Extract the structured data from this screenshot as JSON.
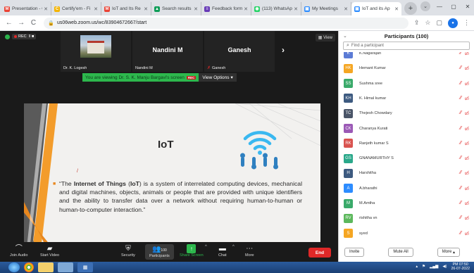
{
  "browser": {
    "tabs": [
      {
        "label": "Presentation - G",
        "fav_color": "#ea4335",
        "fav_glyph": "M"
      },
      {
        "label": "Certify'em - Fi",
        "fav_color": "#f4b400",
        "fav_glyph": "C"
      },
      {
        "label": "IoT and Its Re",
        "fav_color": "#ea4335",
        "fav_glyph": "M"
      },
      {
        "label": "Search results",
        "fav_color": "#0f9d58",
        "fav_glyph": "▲"
      },
      {
        "label": "Feedback form",
        "fav_color": "#673ab7",
        "fav_glyph": "≡"
      },
      {
        "label": "(113) WhatsApp",
        "fav_color": "#25d366",
        "fav_glyph": "◉"
      },
      {
        "label": "My Meetings",
        "fav_color": "#2d8cff",
        "fav_glyph": "▣"
      },
      {
        "label": "IoT and its Ap",
        "fav_color": "#2d8cff",
        "fav_glyph": "▣"
      }
    ],
    "url": "us06web.zoom.us/wc/83904672667/start"
  },
  "zoom": {
    "view_label": "View",
    "thumbnails": [
      {
        "name": "Dr. K. Logesh",
        "big": ""
      },
      {
        "name": "Nandini M",
        "big": "Nandini M"
      },
      {
        "name": "Ganesh",
        "big": "Ganesh"
      }
    ],
    "banner_text": "You are viewing Dr. S. K. Manju Bargavi's screen",
    "rec_badge": "REC",
    "view_options": "View Options",
    "slide": {
      "title": "IoT",
      "body_pre": "“The ",
      "body_bold1": "Internet of Things",
      "body_mid": " (",
      "body_bold2": "IoT",
      "body_post": ") is a system of interrelated computing devices, mechanical and digital machines, objects, animals or people that are provided with unique identifiers and the ability to transfer data over a network without requiring human-to-human or human-to-computer interaction.”"
    },
    "toolbar": {
      "join_audio": "Join Audio",
      "start_video": "Start Video",
      "security": "Security",
      "participants": "Participants",
      "participants_count": "100",
      "share_screen": "Share Screen",
      "chat": "Chat",
      "more": "More",
      "end": "End"
    }
  },
  "panel": {
    "title": "Participants (100)",
    "search_placeholder": "Find a participant",
    "participants": [
      {
        "initials": "K",
        "name": "K.Nagarajan",
        "color": "#5b7bd5"
      },
      {
        "initials": "HK",
        "name": "Hemant Kumar",
        "color": "#f5a623"
      },
      {
        "initials": "SS",
        "name": "Sushma sree",
        "color": "#3aaa6a"
      },
      {
        "initials": "KH",
        "name": "K. Himal kumar",
        "color": "#3d5a80"
      },
      {
        "initials": "TC",
        "name": "Thejesh Chowdary",
        "color": "#4a5568"
      },
      {
        "initials": "CK",
        "name": "Charanya Kurati",
        "color": "#9b59b6"
      },
      {
        "initials": "RK",
        "name": "Ranjeth kumar S",
        "color": "#d9534f"
      },
      {
        "initials": "GS",
        "name": "GNANAMURTHY S",
        "color": "#2aa88a"
      },
      {
        "initials": "H",
        "name": "Harshitha",
        "color": "#3d5a80"
      },
      {
        "initials": "A",
        "name": "A.bharathi",
        "color": "#2d8cff"
      },
      {
        "initials": "M",
        "name": "M.Amtha",
        "color": "#3aaa6a"
      },
      {
        "initials": "RV",
        "name": "rishitha vn",
        "color": "#5cb85c"
      },
      {
        "initials": "S",
        "name": "syed",
        "color": "#f5a623"
      }
    ],
    "invite": "Invite",
    "mute_all": "Mute All",
    "more": "More"
  },
  "taskbar": {
    "time": "PM 07:50",
    "date": "26-07-2022"
  }
}
